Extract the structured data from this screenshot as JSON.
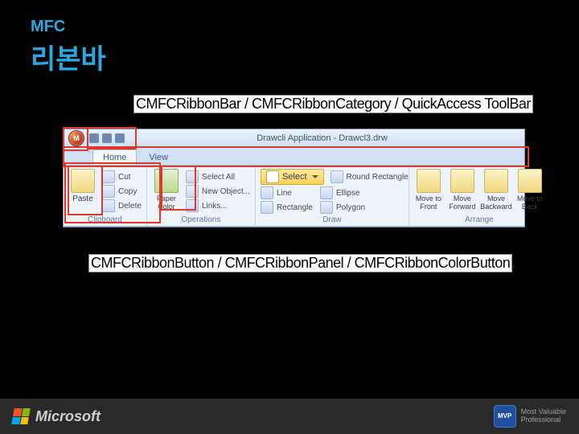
{
  "header": {
    "small": "MFC",
    "big": "리본바"
  },
  "labels": {
    "top": "CMFCRibbonBar / CMFCRibbonCategory / QuickAccess ToolBar",
    "bottom": "CMFCRibbonButton / CMFCRibbonPanel / CMFCRibbonColorButton"
  },
  "app": {
    "orb_letter": "M",
    "title": "Drawcli Application - Drawcl3.drw",
    "tabs": [
      "Home",
      "View"
    ],
    "active_tab": 0,
    "panels": [
      {
        "title": "Clipboard",
        "big": [
          {
            "label": "Paste"
          }
        ],
        "small": [
          {
            "label": "Cut"
          },
          {
            "label": "Copy"
          },
          {
            "label": "Delete"
          }
        ]
      },
      {
        "title": "Operations",
        "big": [
          {
            "label": "Paper Color"
          }
        ],
        "small": [
          {
            "label": "Select All"
          },
          {
            "label": "New Object..."
          },
          {
            "label": "Links..."
          }
        ]
      },
      {
        "title": "Draw",
        "highlight": {
          "label": "Select"
        },
        "small_left": [
          {
            "label": "Line"
          },
          {
            "label": "Rectangle"
          }
        ],
        "small_right": [
          {
            "label": "Round Rectangle"
          },
          {
            "label": "Ellipse"
          },
          {
            "label": "Polygon"
          }
        ]
      },
      {
        "title": "Arrange",
        "big": [
          {
            "label": "Move to Front"
          },
          {
            "label": "Move Forward"
          },
          {
            "label": "Move Backward"
          },
          {
            "label": "Move to Back"
          }
        ]
      }
    ]
  },
  "footer": {
    "brand": "Microsoft",
    "mvp_top": "Most Valuable",
    "mvp_bot": "Professional",
    "mvp_badge": "MVP"
  }
}
